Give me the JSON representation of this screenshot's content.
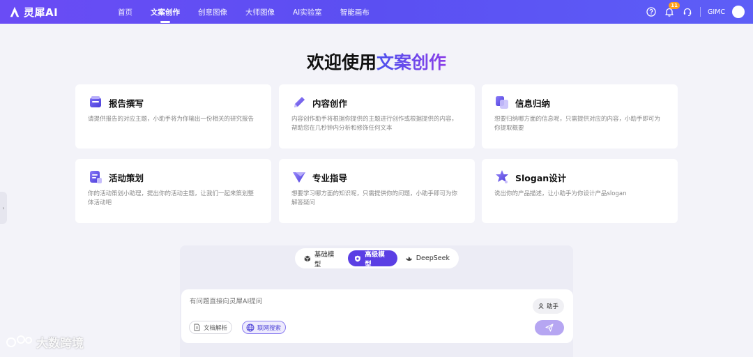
{
  "brand": {
    "name": "灵犀AI"
  },
  "nav": {
    "items": [
      {
        "label": "首页"
      },
      {
        "label": "文案创作",
        "active": true
      },
      {
        "label": "创意图像"
      },
      {
        "label": "大师图像"
      },
      {
        "label": "AI实验室"
      },
      {
        "label": "智能画布"
      }
    ]
  },
  "toolbar": {
    "notification_count": "11",
    "user_name": "GIMC"
  },
  "hero": {
    "title_prefix": "欢迎使用",
    "title_accent": "文案创作"
  },
  "cards": [
    {
      "title": "报告撰写",
      "desc": "请提供报告的对应主题，小助手将为你输出一份相关的研究报告",
      "icon": "report-icon"
    },
    {
      "title": "内容创作",
      "desc": "内容创作助手将根据你提供的主题进行创作或根据提供的内容，帮助您在几秒钟内分析和修饰任何文本",
      "icon": "pen-icon"
    },
    {
      "title": "信息归纳",
      "desc": "想要归纳哪方面的信息呢，只需提供对应的内容，小助手即可为你提取概要",
      "icon": "summary-icon"
    },
    {
      "title": "活动策划",
      "desc": "你的活动策划小助理，提出你的活动主题，让我们一起来策划整体活动吧",
      "icon": "activity-icon"
    },
    {
      "title": "专业指导",
      "desc": "想要学习哪方面的知识呢，只需提供你的问题，小助手即可为你解答疑问",
      "icon": "guide-icon"
    },
    {
      "title": "Slogan设计",
      "desc": "说出你的产品描述，让小助手为你设计产品slogan",
      "icon": "star-icon"
    }
  ],
  "models": {
    "tabs": [
      {
        "label": "基础模型",
        "icon": "cube-icon"
      },
      {
        "label": "高级模型",
        "icon": "shield-icon",
        "active": true
      },
      {
        "label": "DeepSeek",
        "icon": "whale-icon"
      }
    ]
  },
  "input": {
    "placeholder": "有问题直接向灵犀AI提问",
    "assistant_label": "助手",
    "doc_label": "文档解析",
    "web_label": "联网搜索"
  },
  "watermark": {
    "text": "大数跨境"
  },
  "colors": {
    "accent": "#5b3fe4",
    "nav_gradient_start": "#6a4cf5",
    "nav_gradient_end": "#5d5ef7"
  }
}
